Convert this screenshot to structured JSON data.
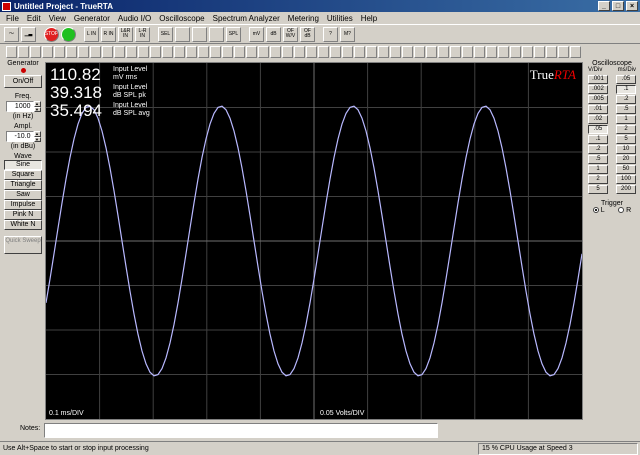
{
  "window": {
    "title": "Untitled Project - TrueRTA"
  },
  "menu": [
    "File",
    "Edit",
    "View",
    "Generator",
    "Audio I/O",
    "Oscilloscope",
    "Spectrum Analyzer",
    "Metering",
    "Utilities",
    "Help"
  ],
  "toolbar": {
    "buttons": [
      "",
      "",
      "STOP",
      "",
      "L IN",
      "R IN",
      "L&R IN",
      "L-R IN",
      "",
      "SEL",
      "",
      "",
      "",
      "SPL",
      "mV",
      "dB",
      "OF W/V",
      "OF dB",
      "?",
      "M?"
    ]
  },
  "generator": {
    "title": "Generator",
    "on_off_label": "On/Off",
    "freq_label": "Freq.",
    "freq_value": "1000",
    "freq_unit": "(in Hz)",
    "ampl_label": "Ampl.",
    "ampl_value": "-10.0",
    "ampl_unit": "(in dBu)",
    "wave_label": "Wave",
    "waves": [
      "Sine",
      "Square",
      "Triangle",
      "Saw",
      "Impulse",
      "Pink N",
      "White N"
    ],
    "selected_wave": "Sine",
    "quick_sweep_label": "Quick Sweep"
  },
  "scope": {
    "readouts": [
      {
        "value": "110.82",
        "label1": "Input Level",
        "label2": "mV rms"
      },
      {
        "value": "39.318",
        "label1": "Input Level",
        "label2": "dB SPL pk"
      },
      {
        "value": "35.494",
        "label1": "Input Level",
        "label2": "dB SPL avg"
      }
    ],
    "logo_true": "True",
    "logo_rta": "RTA",
    "time_scale": "0.1   ms/DIV",
    "volt_scale": "0.05   Volts/DIV",
    "trace_color": "#b8b8ff",
    "grid_color": "#404040"
  },
  "oscilloscope": {
    "title": "Oscilloscope",
    "vdiv_header": "V/Div",
    "msdiv_header": "ms/Div",
    "vdiv": [
      ".001",
      ".002",
      ".005",
      ".01",
      ".02",
      ".05",
      ".1",
      ".2",
      ".5",
      "1",
      "2",
      "5"
    ],
    "msdiv": [
      ".05",
      ".1",
      ".2",
      ".5",
      "1",
      "2",
      "5",
      "10",
      "20",
      "50",
      "100",
      "200"
    ],
    "selected_vdiv": ".05",
    "selected_msdiv": ".1",
    "trigger_label": "Trigger",
    "trigger_l": "L",
    "trigger_r": "R"
  },
  "notes": {
    "label": "Notes:"
  },
  "status": {
    "hint": "Use Alt+Space to start or stop input processing",
    "cpu": "15 % CPU Usage at Speed 3"
  }
}
